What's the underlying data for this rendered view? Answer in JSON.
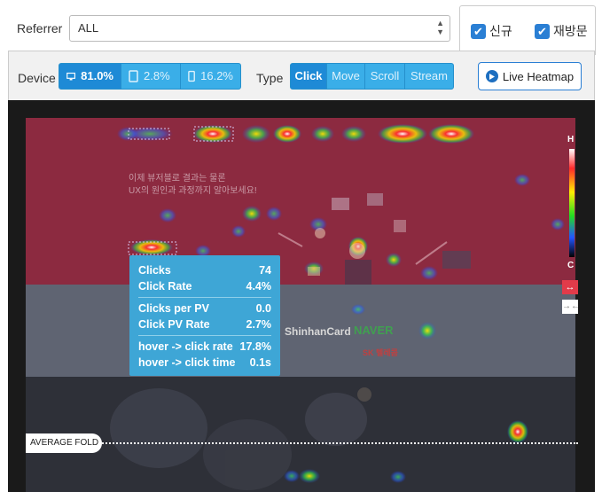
{
  "referrer": {
    "label": "Referrer",
    "value": "ALL"
  },
  "visitor_filter": [
    {
      "label": "신규",
      "checked": true
    },
    {
      "label": "재방문",
      "checked": true
    }
  ],
  "device": {
    "label": "Device",
    "options": [
      {
        "name": "desktop",
        "value": "81.0%",
        "active": true
      },
      {
        "name": "tablet",
        "value": "2.8%",
        "active": false
      },
      {
        "name": "mobile",
        "value": "16.2%",
        "active": false
      }
    ]
  },
  "type": {
    "label": "Type",
    "options": [
      {
        "label": "Click",
        "active": true
      },
      {
        "label": "Move",
        "active": false
      },
      {
        "label": "Scroll",
        "active": false
      },
      {
        "label": "Stream",
        "active": false
      }
    ]
  },
  "live_heatmap": {
    "label": "Live Heatmap"
  },
  "legend": {
    "high": "H",
    "low": "C"
  },
  "page_preview": {
    "hero_line1": "이제 뷰저블로 결과는 물론",
    "hero_line2": "UX의 원인과 과정까지 알아보세요!",
    "logo_shinhan": "ShinhanCard",
    "logo_naver": "NAVER",
    "logo_sk": "SK 텔레콤"
  },
  "tooltip": {
    "clicks": {
      "label": "Clicks",
      "value": "74"
    },
    "click_rate": {
      "label": "Click Rate",
      "value": "4.4%"
    },
    "clicks_per_pv": {
      "label": "Clicks per PV",
      "value": "0.0"
    },
    "click_pv_rate": {
      "label": "Click PV Rate",
      "value": "2.7%"
    },
    "hover_click_rate": {
      "label": "hover -> click rate",
      "value": "17.8%"
    },
    "hover_click_time": {
      "label": "hover -> click time",
      "value": "0.1s"
    }
  },
  "average_fold": {
    "label": "AVERAGE FOLD"
  },
  "colors": {
    "accent": "#1e8ad6",
    "segment": "#3aaee8",
    "tooltip": "#3ea6d6",
    "hero": "#8c2a40"
  }
}
